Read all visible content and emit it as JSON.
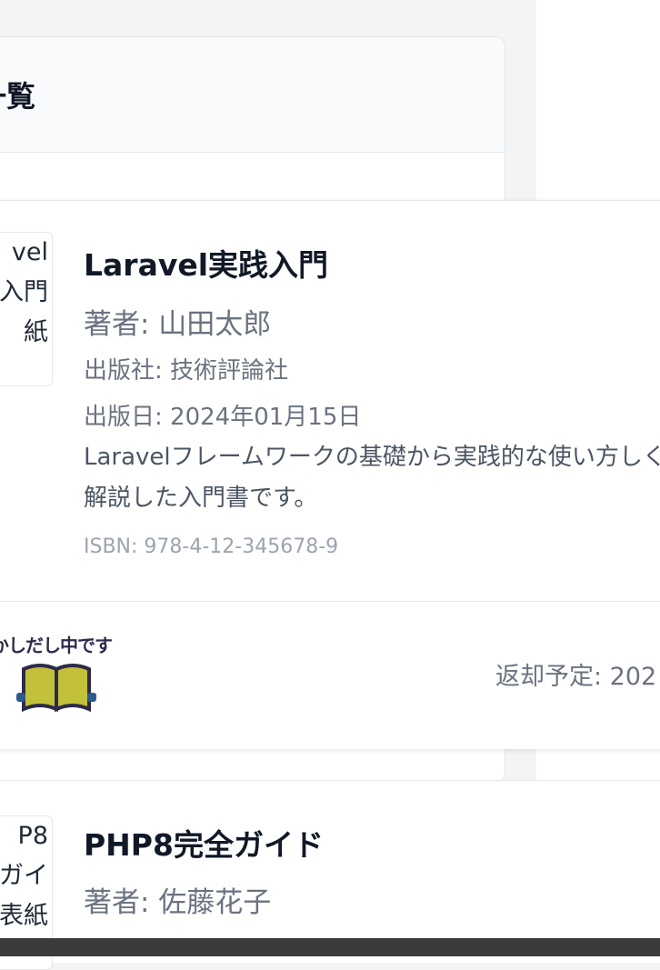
{
  "panel": {
    "title": "一覧"
  },
  "books": [
    {
      "cover_lines": [
        "vel",
        "入門",
        "紙"
      ],
      "title": "Laravel実践入門",
      "author": "著者: 山田太郎",
      "publisher": "出版社: 技術評論社",
      "published": "出版日: 2024年01月15日",
      "description": "Laravelフレームワークの基礎から実践的な使い方しく解説した入門書です。",
      "isbn": "ISBN: 978-4-12-345678-9",
      "lending_badge": "かしだし中です",
      "due": "返却予定: 202"
    },
    {
      "cover_lines": [
        "P8",
        "ガイ",
        "表紙"
      ],
      "title": "PHP8完全ガイド",
      "author": "著者: 佐藤花子"
    }
  ],
  "colors": {
    "book_icon": "#c3c13b",
    "book_outline": "#2d2a4a",
    "hands": "#2f5b8c"
  }
}
